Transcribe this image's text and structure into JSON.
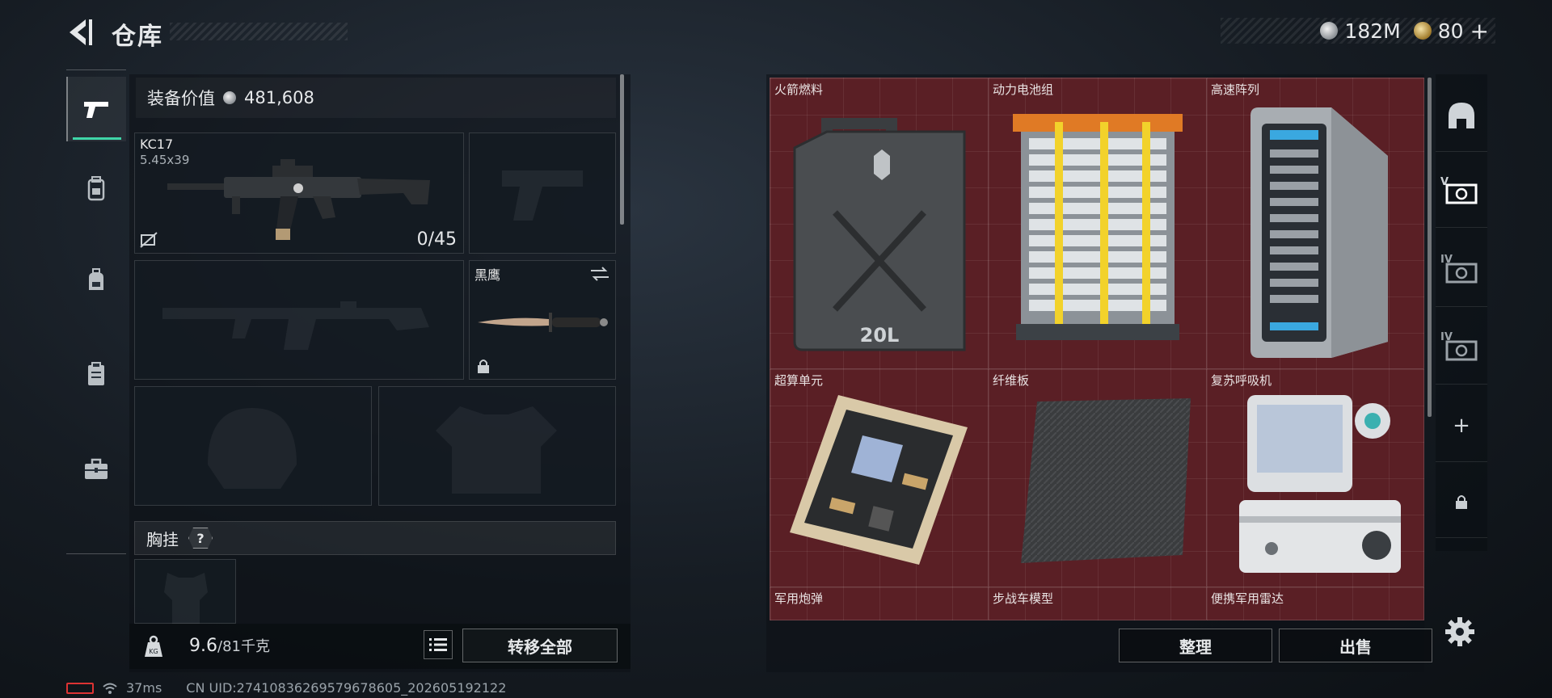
{
  "header": {
    "title": "仓库"
  },
  "currency": [
    {
      "name": "silver-coin",
      "amount": "182M",
      "color": "#c8cdd1"
    },
    {
      "name": "gold-coin",
      "amount": "80",
      "color": "#d9b45a"
    }
  ],
  "plus_label": "+",
  "tabs": [
    {
      "icon": "pistol-icon",
      "active": true
    },
    {
      "icon": "backpack-armor-icon",
      "active": false
    },
    {
      "icon": "backpack-icon",
      "active": false
    },
    {
      "icon": "clipboard-icon",
      "active": false
    },
    {
      "icon": "toolbox-icon",
      "active": false
    }
  ],
  "loadout": {
    "equip_value_label": "装备价值",
    "equip_value": "481,608",
    "primary": {
      "name": "KC17",
      "caliber": "5.45x39",
      "ammo": "0/45"
    },
    "melee": {
      "name": "黑鹰"
    },
    "chest_rig_label": "胸挂",
    "help": "?"
  },
  "weight": {
    "current": "9.6",
    "max": "/81千克"
  },
  "buttons": {
    "transfer_all": "转移全部",
    "sort": "整理",
    "sell": "出售"
  },
  "status": {
    "ping": "37ms",
    "uid": "CN UID:27410836269579678605_202605192122"
  },
  "inventory": {
    "items": [
      {
        "label": "火箭燃料"
      },
      {
        "label": "动力电池组"
      },
      {
        "label": "高速阵列"
      },
      {
        "label": "超算单元"
      },
      {
        "label": "纤维板"
      },
      {
        "label": "复苏呼吸机"
      },
      {
        "label": "军用炮弹"
      },
      {
        "label": "步战车模型"
      },
      {
        "label": "便携军用雷达"
      }
    ],
    "grid_color": "#5a1f25",
    "jerrycan_text": "20L"
  },
  "right_tabs": [
    {
      "icon": "helmet-icon",
      "label": ""
    },
    {
      "icon": "case-icon",
      "label": "V"
    },
    {
      "icon": "case-icon",
      "label": "IV"
    },
    {
      "icon": "case-icon",
      "label": "IV"
    },
    {
      "icon": "plus-icon",
      "label": "+"
    },
    {
      "icon": "lock-icon",
      "label": ""
    }
  ]
}
